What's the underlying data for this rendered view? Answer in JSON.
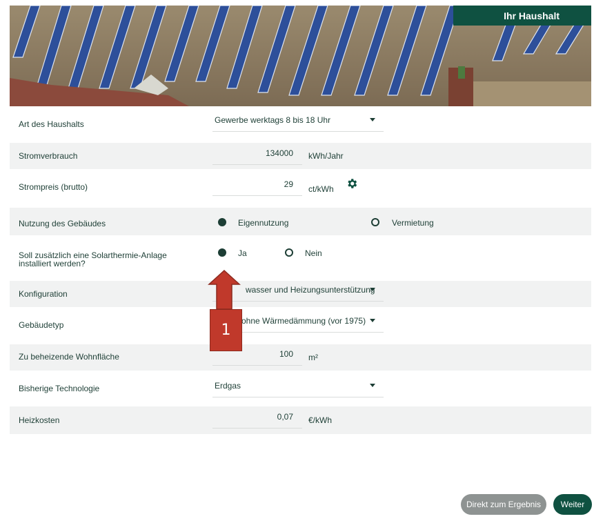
{
  "header": {
    "tab_label": "Ihr Haushalt"
  },
  "form": {
    "household_type": {
      "label": "Art des Haushalts",
      "value": "Gewerbe werktags 8 bis 18 Uhr"
    },
    "consumption": {
      "label": "Stromverbrauch",
      "value": "134000",
      "unit": "kWh/Jahr"
    },
    "price": {
      "label": "Strompreis (brutto)",
      "value": "29",
      "unit": "ct/kWh"
    },
    "usage": {
      "label": "Nutzung des Gebäudes",
      "option_1": "Eigennutzung",
      "option_2": "Vermietung",
      "selected": "Eigennutzung"
    },
    "solarthermie": {
      "label_line1": "Soll zusätzlich eine Solarthermie-Anlage",
      "label_line2": "installiert werden?",
      "option_1": "Ja",
      "option_2": "Nein",
      "selected": "Ja"
    },
    "configuration": {
      "label": "Konfiguration",
      "value": "Warmwasser und Heizungsunterstützung",
      "visible_value": "wasser und Heizungsunterstützung"
    },
    "building_type": {
      "label": "Gebäudetyp",
      "value": "ohne Wärmedämmung (vor 1975)"
    },
    "living_area": {
      "label": "Zu beheizende Wohnfläche",
      "value": "100",
      "unit": "m²"
    },
    "technology": {
      "label": "Bisherige Technologie",
      "value": "Erdgas"
    },
    "heating_costs": {
      "label": "Heizkosten",
      "value": "0,07",
      "unit": "€/kWh"
    }
  },
  "callout": {
    "number": "1"
  },
  "buttons": {
    "direct_label": "Direkt zum Ergebnis",
    "next_label": "Weiter"
  },
  "colors": {
    "brand_green": "#0f5141",
    "row_shade": "#f1f2f2",
    "callout_red": "#c0392b"
  }
}
